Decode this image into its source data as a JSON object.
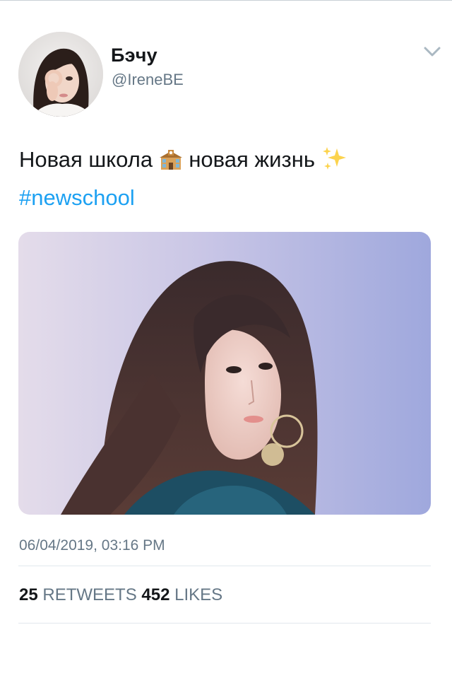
{
  "author": {
    "display_name": "Бэчу",
    "handle": "@IreneBE"
  },
  "tweet": {
    "text_part1": "Новая школа",
    "text_part2": "новая жизнь",
    "emoji_1": "school-building-icon",
    "emoji_2": "sparkles-icon",
    "hashtag": "#newschool"
  },
  "timestamp": "06/04/2019, 03:16 PM",
  "stats": {
    "retweets_count": "25",
    "retweets_label": "RETWEETS",
    "likes_count": "452",
    "likes_label": "LIKES"
  },
  "colors": {
    "link": "#1da1f2",
    "secondary_text": "#657786",
    "primary_text": "#14171a",
    "divider": "#e1e8ed"
  }
}
